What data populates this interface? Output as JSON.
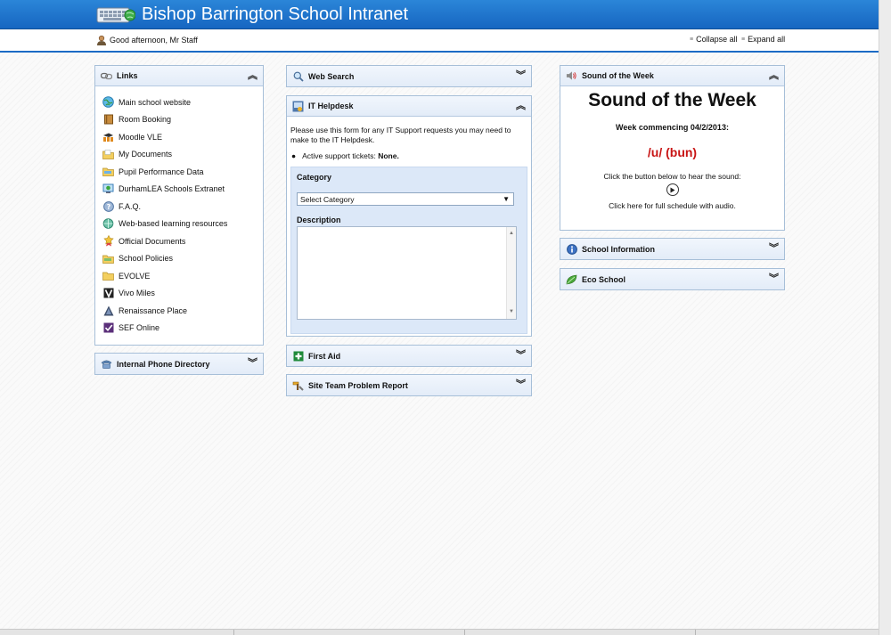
{
  "header": {
    "title": "Bishop Barrington School Intranet",
    "logo_icon": "keyboard-globe-icon"
  },
  "subbar": {
    "greeting": "Good afternoon, Mr Staff",
    "collapse_all": "Collapse all",
    "expand_all": "Expand all"
  },
  "colors": {
    "header_blue": "#1e75cf",
    "panel_border": "#a7bfd8",
    "sound_red": "#c81414",
    "form_bg": "#dce8f8"
  },
  "links_panel": {
    "title": "Links",
    "items": [
      {
        "label": "Main school website",
        "icon": "globe-icon"
      },
      {
        "label": "Room Booking",
        "icon": "book-icon"
      },
      {
        "label": "Moodle VLE",
        "icon": "moodle-icon"
      },
      {
        "label": "My Documents",
        "icon": "folder-documents-icon"
      },
      {
        "label": "Pupil Performance Data",
        "icon": "folder-icon"
      },
      {
        "label": "DurhamLEA Schools Extranet",
        "icon": "network-icon"
      },
      {
        "label": "F.A.Q.",
        "icon": "help-icon"
      },
      {
        "label": "Web-based learning resources",
        "icon": "web-icon"
      },
      {
        "label": "Official Documents",
        "icon": "award-icon"
      },
      {
        "label": "School Policies",
        "icon": "folder-icon"
      },
      {
        "label": "EVOLVE",
        "icon": "folder-icon"
      },
      {
        "label": "Vivo Miles",
        "icon": "vivo-icon"
      },
      {
        "label": "Renaissance Place",
        "icon": "renaissance-icon"
      },
      {
        "label": "SEF Online",
        "icon": "checkmark-icon"
      }
    ]
  },
  "phone_panel": {
    "title": "Internal Phone Directory"
  },
  "web_search": {
    "title": "Web Search"
  },
  "helpdesk": {
    "title": "IT Helpdesk",
    "intro": "Please use this form for any IT Support requests you may need to make to the IT Helpdesk.",
    "tickets_label": "Active support tickets:",
    "tickets_value": "None.",
    "category_label": "Category",
    "category_value": "Select Category",
    "description_label": "Description"
  },
  "first_aid": {
    "title": "First Aid"
  },
  "site_team": {
    "title": "Site Team Problem Report"
  },
  "sotw": {
    "title": "Sound of the Week",
    "heading": "Sound of the Week",
    "week": "Week commencing 04/2/2013:",
    "sound": "/u/ (bun)",
    "instruction": "Click the button below to hear the sound:",
    "schedule": "Click here for full schedule with audio."
  },
  "school_info": {
    "title": "School Information"
  },
  "eco": {
    "title": "Eco School"
  }
}
